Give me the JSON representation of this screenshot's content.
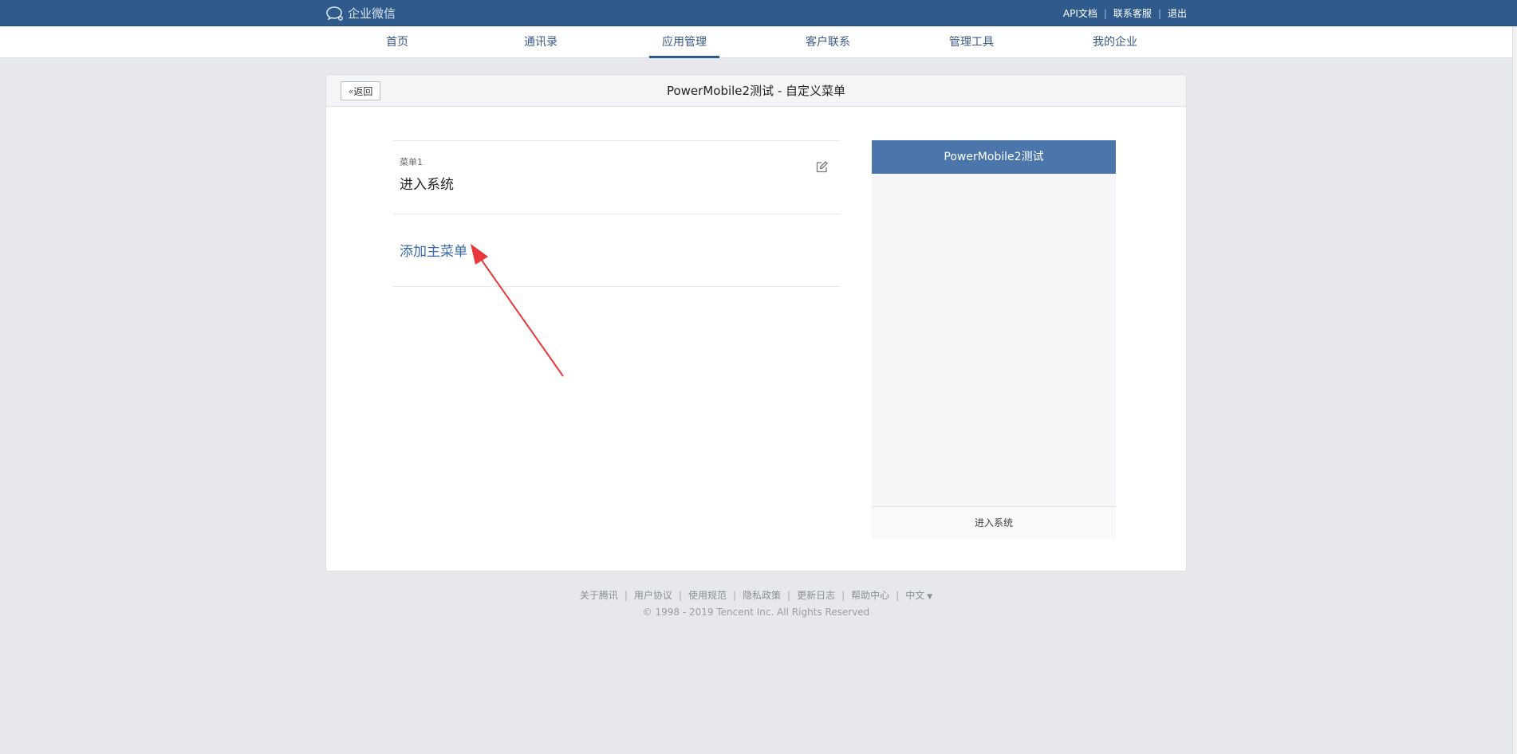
{
  "topbar": {
    "logo_text": "企业微信",
    "links": [
      "API文档",
      "联系客服",
      "退出"
    ]
  },
  "nav": {
    "items": [
      "首页",
      "通讯录",
      "应用管理",
      "客户联系",
      "管理工具",
      "我的企业"
    ],
    "active": "应用管理"
  },
  "card": {
    "back_label": "返回",
    "title": "PowerMobile2测试 - 自定义菜单"
  },
  "menus": [
    {
      "sub_label": "菜单1",
      "name": "进入系统"
    }
  ],
  "add_menu_label": "添加主菜单",
  "phone": {
    "title": "PowerMobile2测试",
    "footer_menu": "进入系统"
  },
  "footer": {
    "links": [
      "关于腾讯",
      "用户协议",
      "使用规范",
      "隐私政策",
      "更新日志",
      "帮助中心",
      "中文"
    ],
    "copyright": "© 1998 - 2019 Tencent Inc. All Rights Reserved"
  },
  "colors": {
    "topbar": "#2e5a8c",
    "accent": "#3a6aa8",
    "phone_header": "#4a76ac",
    "annotation_arrow": "#e8383d"
  }
}
